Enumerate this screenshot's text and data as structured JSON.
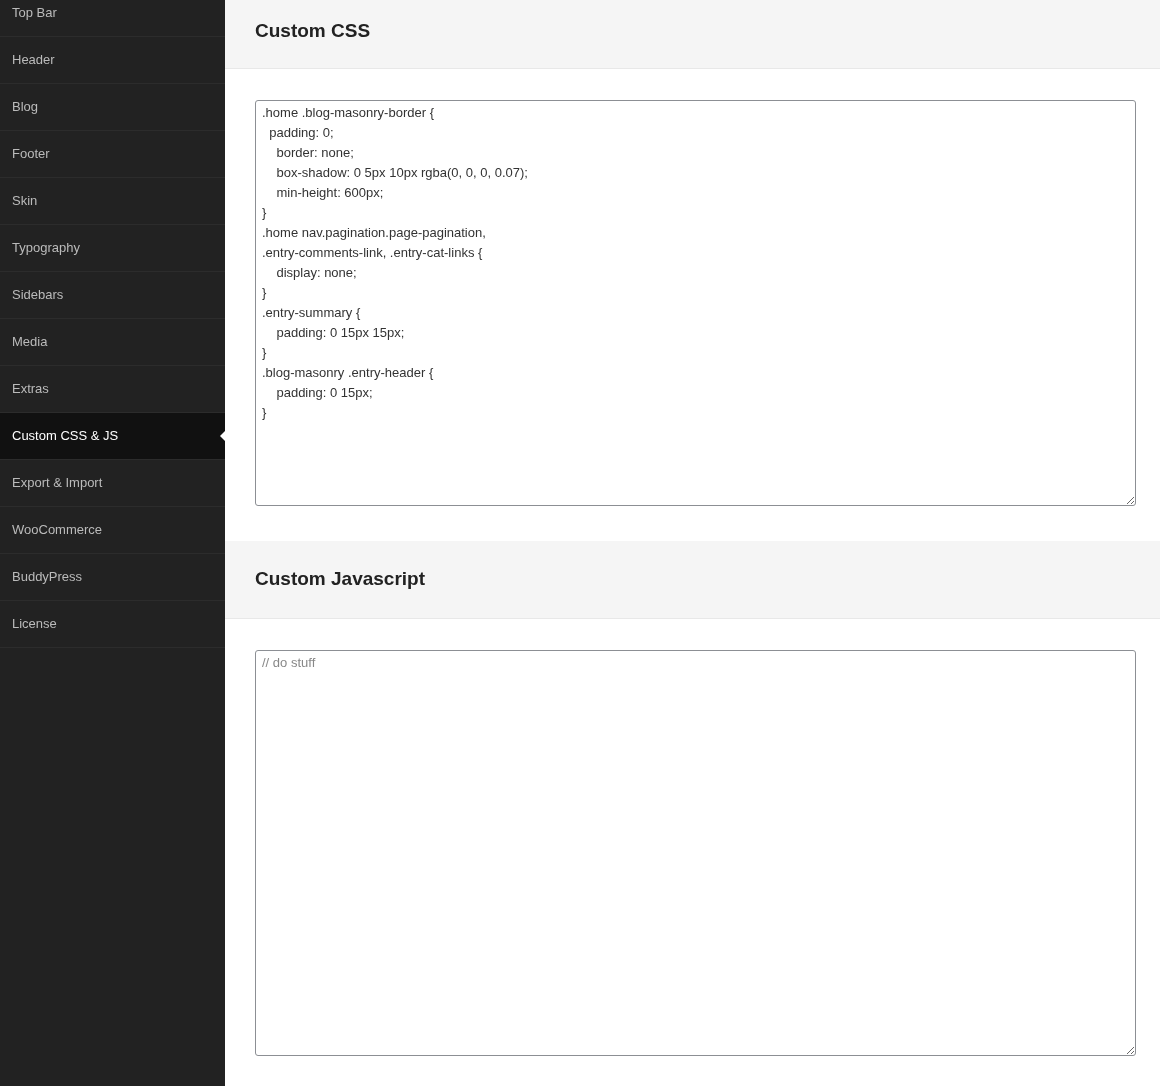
{
  "sidebar": {
    "items": [
      {
        "label": "Top Bar",
        "selected": false
      },
      {
        "label": "Header",
        "selected": false
      },
      {
        "label": "Blog",
        "selected": false
      },
      {
        "label": "Footer",
        "selected": false
      },
      {
        "label": "Skin",
        "selected": false
      },
      {
        "label": "Typography",
        "selected": false
      },
      {
        "label": "Sidebars",
        "selected": false
      },
      {
        "label": "Media",
        "selected": false
      },
      {
        "label": "Extras",
        "selected": false
      },
      {
        "label": "Custom CSS & JS",
        "selected": true
      },
      {
        "label": "Export & Import",
        "selected": false
      },
      {
        "label": "WooCommerce",
        "selected": false
      },
      {
        "label": "BuddyPress",
        "selected": false
      },
      {
        "label": "License",
        "selected": false
      }
    ]
  },
  "sections": [
    {
      "title": "Custom CSS",
      "editor": {
        "value": ".home .blog-masonry-border {\n  padding: 0;\n    border: none;\n    box-shadow: 0 5px 10px rgba(0, 0, 0, 0.07);\n    min-height: 600px;\n}\n.home nav.pagination.page-pagination,\n.entry-comments-link, .entry-cat-links {\n    display: none;\n}\n.entry-summary {\n    padding: 0 15px 15px;\n}\n.blog-masonry .entry-header {\n    padding: 0 15px;\n}"
      }
    },
    {
      "title": "Custom Javascript",
      "editor": {
        "placeholder": "// do stuff"
      }
    }
  ]
}
